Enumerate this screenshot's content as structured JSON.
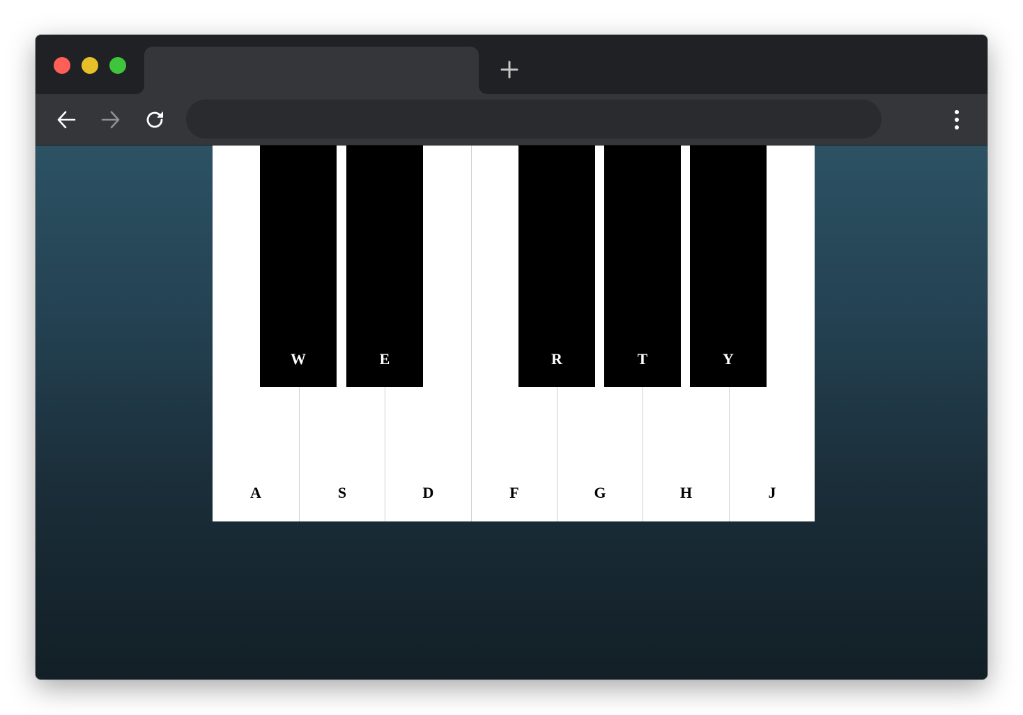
{
  "browser": {
    "colors": {
      "close": "#ff5f57",
      "minimize": "#e6bf29",
      "maximize": "#3fc53c",
      "frame": "#202124",
      "toolbar": "#35363a",
      "omnibox": "#292b2e"
    },
    "tab": {
      "title": ""
    },
    "address_bar": {
      "value": ""
    },
    "icons": {
      "new_tab": "plus-icon",
      "back": "arrow-left-icon",
      "forward": "arrow-right-icon",
      "reload": "reload-icon",
      "menu": "kebab-menu-icon"
    }
  },
  "piano": {
    "white_keys": [
      {
        "label": "A"
      },
      {
        "label": "S"
      },
      {
        "label": "D"
      },
      {
        "label": "F"
      },
      {
        "label": "G"
      },
      {
        "label": "H"
      },
      {
        "label": "J"
      }
    ],
    "black_keys": [
      {
        "label": "W"
      },
      {
        "label": "E"
      },
      {
        "label": "R"
      },
      {
        "label": "T"
      },
      {
        "label": "Y"
      }
    ],
    "colors": {
      "white_key": "#ffffff",
      "black_key": "#000000",
      "background_top": "#2c5264",
      "background_bottom": "#121f26"
    }
  }
}
